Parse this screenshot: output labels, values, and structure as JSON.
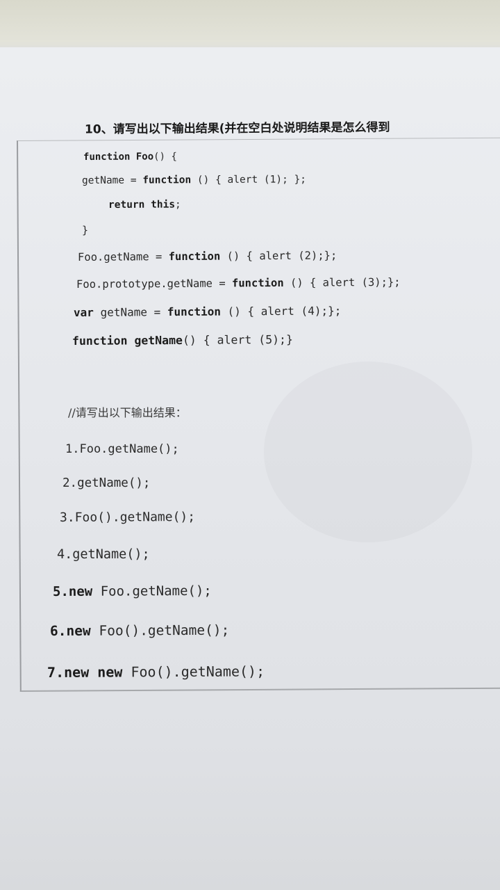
{
  "question_title": "10、请写出以下输出结果(并在空白处说明结果是怎么得到",
  "code": {
    "l1_kw": "function Foo",
    "l1_rest": "() {",
    "l2_a": "getName = ",
    "l2_kw": "function",
    "l2_b": " () { alert (1); };",
    "l3_kw": "return this",
    "l3_b": ";",
    "l4": "}",
    "l5_a": "Foo.getName = ",
    "l5_kw": "function",
    "l5_b": " () { alert (2);};",
    "l6_a": "Foo.prototype.getName = ",
    "l6_kw": "function",
    "l6_b": " () { alert (3);};",
    "l7_kw1": "var",
    "l7_a": " getName = ",
    "l7_kw2": "function",
    "l7_b": " () { alert (4);};",
    "l8_kw": "function getName",
    "l8_b": "() { alert (5);}"
  },
  "comment": "//请写出以下输出结果：",
  "questions": {
    "q1": "1.Foo.getName();",
    "q2": "2.getName();",
    "q3": "3.Foo().getName();",
    "q4": "4.getName();",
    "q5_num": "5.",
    "q5_kw": "new",
    "q5_rest": " Foo.getName();",
    "q6_num": "6.",
    "q6_kw": "new",
    "q6_rest": " Foo().getName();",
    "q7_num": "7.",
    "q7_kw": "new new",
    "q7_rest": " Foo().getName();"
  }
}
